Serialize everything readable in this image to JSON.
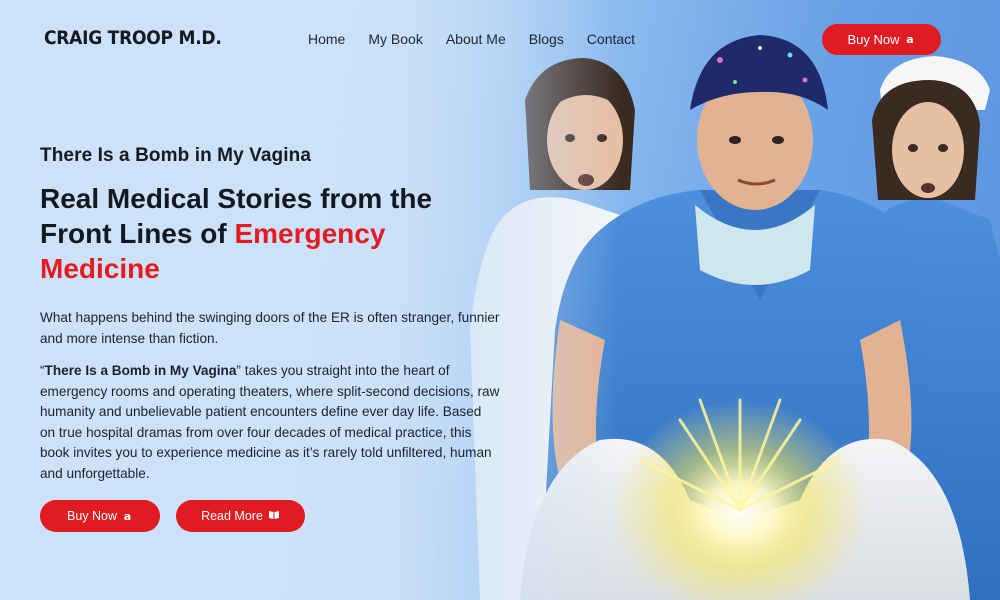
{
  "header": {
    "logo": "CRAIG TROOP M.D.",
    "nav": [
      "Home",
      "My Book",
      "About Me",
      "Blogs",
      "Contact"
    ],
    "buy_label": "Buy Now"
  },
  "hero": {
    "kicker": "There Is a Bomb in My Vagina",
    "headline_part1": "Real Medical Stories from the Front Lines of ",
    "headline_accent": "Emergency Medicine",
    "para1": "What happens behind the swinging doors of the ER is often stranger, funnier and more intense than fiction.",
    "para2_open_quote": "“",
    "para2_bold": "There Is a Bomb in My Vagina",
    "para2_rest": "” takes you straight into the heart of emergency rooms and operating theaters, where split-second decisions, raw humanity and unbelievable patient encounters define ever day life. Based on true hospital dramas from over four decades of medical practice, this book invites you to experience medicine as it’s rarely told unfiltered, human and unforgettable.",
    "buy_label": "Buy Now",
    "read_label": "Read More"
  },
  "icons": {
    "amazon": "amazon-icon",
    "book": "book-icon"
  },
  "colors": {
    "accent": "#e11b22",
    "scrub_blue": "#3f7fce",
    "background": "#bcd8f5"
  }
}
